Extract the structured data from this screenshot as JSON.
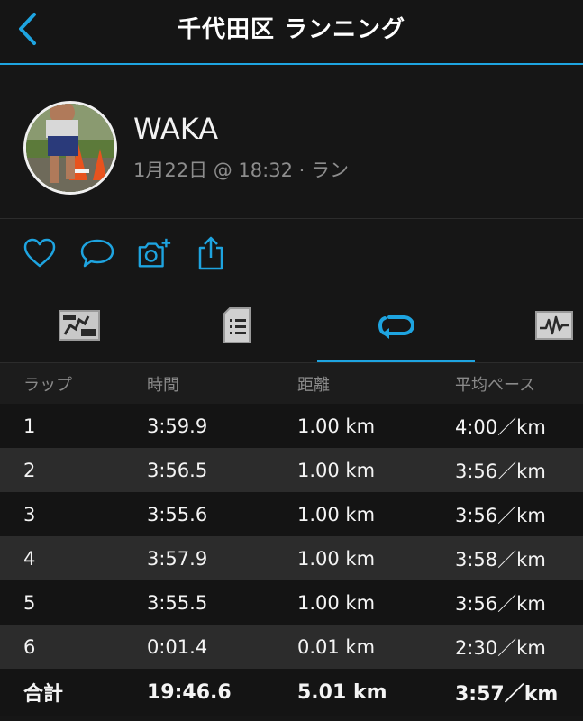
{
  "header": {
    "title": "千代田区 ランニング"
  },
  "profile": {
    "name": "WAKA",
    "meta": "1月22日 @ 18:32 · ラン"
  },
  "actions": [
    "heart-icon",
    "comment-icon",
    "add-photo-icon",
    "share-icon"
  ],
  "tabs": [
    {
      "icon": "map-icon",
      "active": false
    },
    {
      "icon": "details-icon",
      "active": false
    },
    {
      "icon": "laps-icon",
      "active": true
    },
    {
      "icon": "chart-icon",
      "active": false
    }
  ],
  "colors": {
    "accent": "#1ea4e0",
    "background": "#161616"
  },
  "laps": {
    "headers": [
      "ラップ",
      "時間",
      "距離",
      "平均ペース"
    ],
    "rows": [
      [
        "1",
        "3:59.9",
        "1.00 km",
        "4:00／km"
      ],
      [
        "2",
        "3:56.5",
        "1.00 km",
        "3:56／km"
      ],
      [
        "3",
        "3:55.6",
        "1.00 km",
        "3:56／km"
      ],
      [
        "4",
        "3:57.9",
        "1.00 km",
        "3:58／km"
      ],
      [
        "5",
        "3:55.5",
        "1.00 km",
        "3:56／km"
      ],
      [
        "6",
        "0:01.4",
        "0.01 km",
        "2:30／km"
      ]
    ],
    "total": [
      "合計",
      "19:46.6",
      "5.01 km",
      "3:57／km"
    ]
  }
}
